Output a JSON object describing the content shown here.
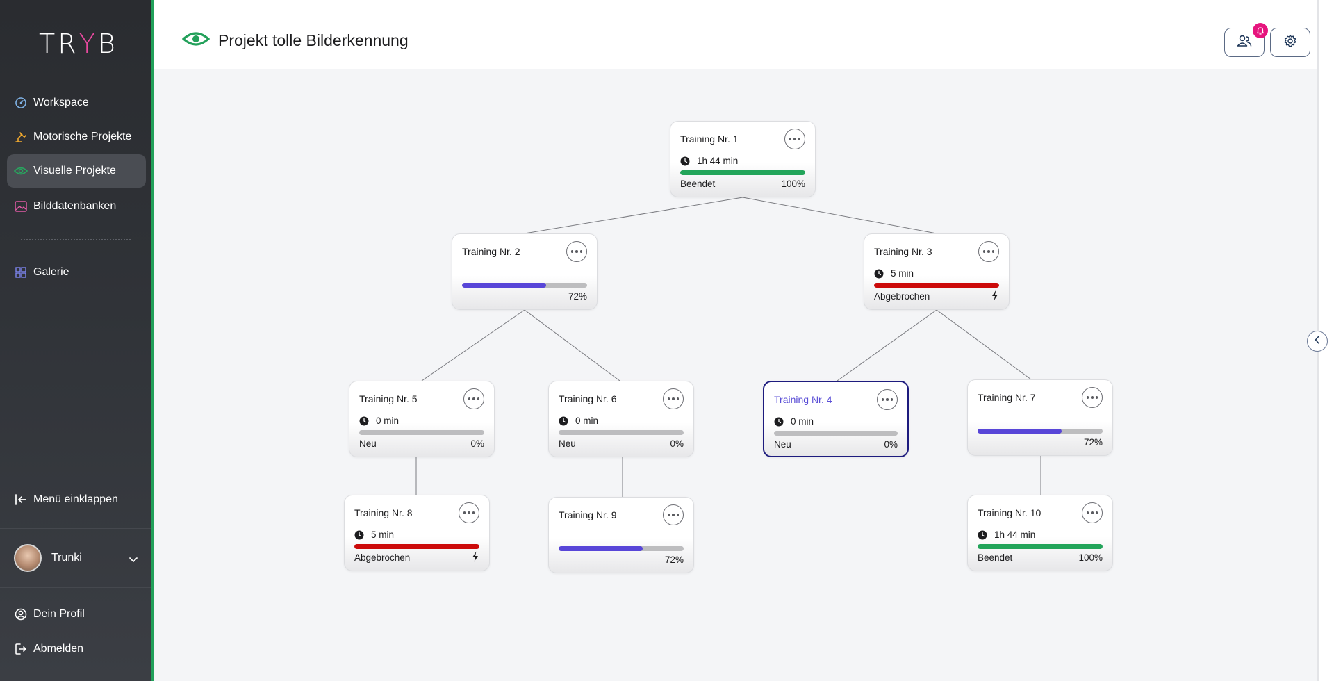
{
  "sidebar": {
    "logo": {
      "left": "TR",
      "mid": "Y",
      "right": "B"
    },
    "nav": [
      {
        "label": "Workspace",
        "icon": "gauge-icon",
        "color": "#7fb2e6"
      },
      {
        "label": "Motorische Projekte",
        "icon": "robot-arm-icon",
        "color": "#f0a92f"
      },
      {
        "label": "Visuelle Projekte",
        "icon": "eye-icon",
        "color": "#28a65f",
        "active": true
      },
      {
        "label": "Bilddatenbanken",
        "icon": "image-icon",
        "color": "#e25aa6"
      },
      {
        "label": "Galerie",
        "icon": "grid-icon",
        "color": "#7d86f0"
      }
    ],
    "collapse_label": "Menü einklappen",
    "user": {
      "name": "Trunki"
    },
    "profile_label": "Dein Profil",
    "logout_label": "Abmelden"
  },
  "header": {
    "title": "Projekt tolle Bilderkennung",
    "accent": "#22a05a",
    "notification_color": "#e6157e"
  },
  "trainings": [
    {
      "id": 1,
      "label": "Training Nr. 1",
      "time": "1h 44 min",
      "status": "Beendet",
      "percent": "100%",
      "progress": 1.0,
      "color": "#23a55a"
    },
    {
      "id": 2,
      "label": "Training Nr. 2",
      "time": "",
      "status": "",
      "percent": "72%",
      "progress": 0.67,
      "color": "#5846d8"
    },
    {
      "id": 3,
      "label": "Training Nr. 3",
      "time": "5 min",
      "status": "Abgebrochen",
      "percent": "",
      "progress": 1.0,
      "color": "#cc0a0a",
      "bolt": true
    },
    {
      "id": 5,
      "label": "Training Nr. 5",
      "time": "0 min",
      "status": "Neu",
      "percent": "0%",
      "progress": 0,
      "color": "#bdbdbf"
    },
    {
      "id": 6,
      "label": "Training Nr. 6",
      "time": "0 min",
      "status": "Neu",
      "percent": "0%",
      "progress": 0,
      "color": "#bdbdbf"
    },
    {
      "id": 4,
      "label": "Training Nr. 4",
      "time": "0 min",
      "status": "Neu",
      "percent": "0%",
      "progress": 0,
      "color": "#bdbdbf",
      "selected": true
    },
    {
      "id": 7,
      "label": "Training Nr. 7",
      "time": "",
      "status": "",
      "percent": "72%",
      "progress": 0.67,
      "color": "#5846d8"
    },
    {
      "id": 8,
      "label": "Training Nr. 8",
      "time": "5 min",
      "status": "Abgebrochen",
      "percent": "",
      "progress": 1.0,
      "color": "#cc0a0a",
      "bolt": true
    },
    {
      "id": 9,
      "label": "Training Nr. 9",
      "time": "",
      "status": "",
      "percent": "72%",
      "progress": 0.67,
      "color": "#5846d8"
    },
    {
      "id": 10,
      "label": "Training Nr. 10",
      "time": "1h 44 min",
      "status": "Beendet",
      "percent": "100%",
      "progress": 1.0,
      "color": "#23a55a"
    }
  ]
}
